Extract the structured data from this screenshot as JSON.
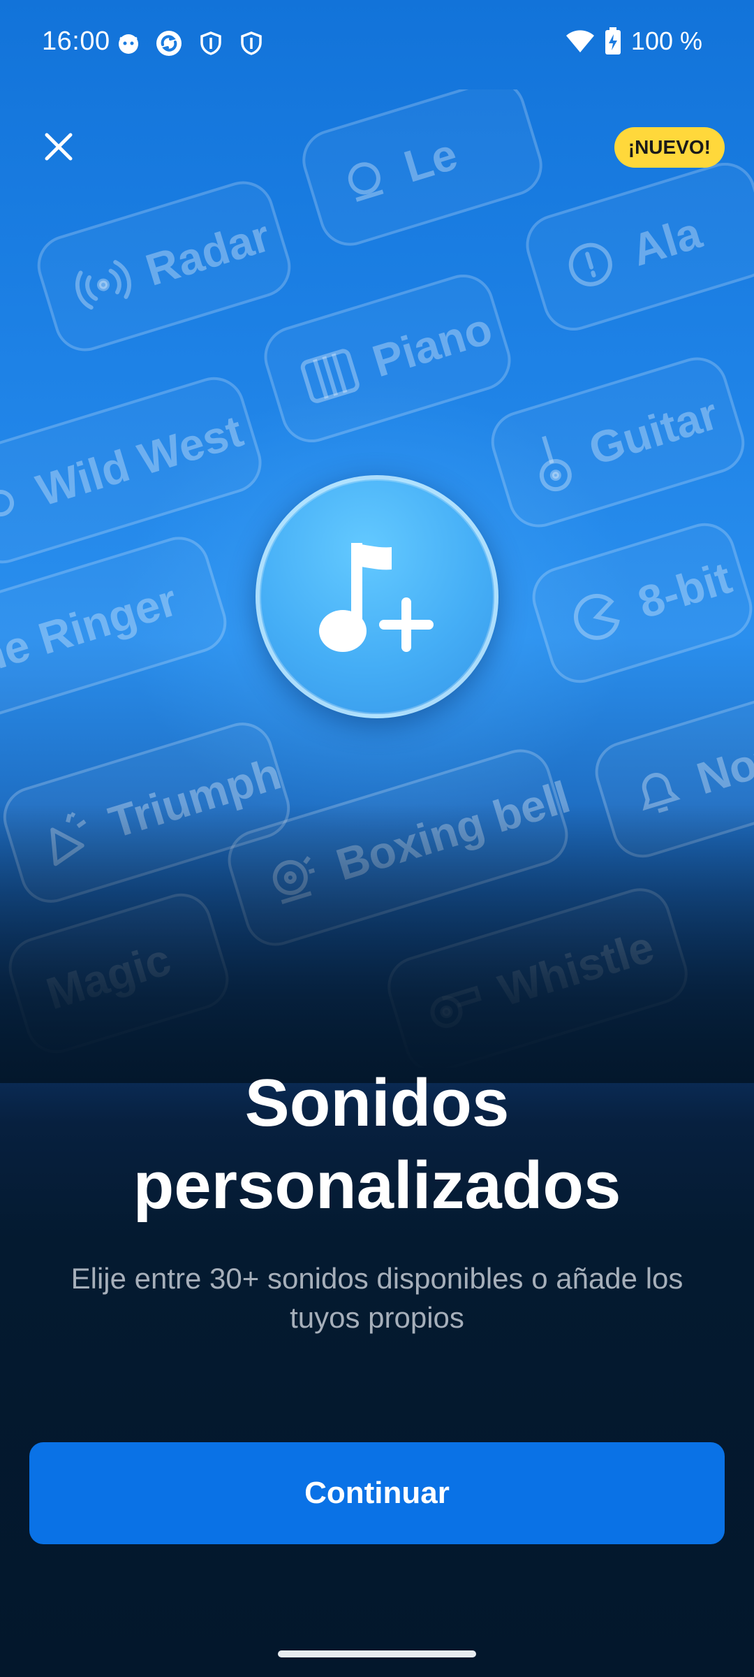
{
  "status_bar": {
    "time": "16:00",
    "battery": "100 %",
    "left_icons": [
      "cat-notification-icon",
      "sync-app-icon",
      "shield-icon",
      "shield-icon"
    ],
    "right_icons": [
      "wifi-icon",
      "battery-charging-icon"
    ]
  },
  "header": {
    "close_icon": "close-icon",
    "badge": "¡NUEVO!"
  },
  "sound_chips": [
    {
      "label": "Radar",
      "icon": "radar-icon"
    },
    {
      "label": "Le",
      "icon": "bell-ring-icon"
    },
    {
      "label": "Ala",
      "icon": "alert-icon"
    },
    {
      "label": "Piano",
      "icon": "piano-icon"
    },
    {
      "label": "Wild West",
      "icon": "wild-west-icon"
    },
    {
      "label": "Guitar",
      "icon": "guitar-icon"
    },
    {
      "label": "one Ringer",
      "icon": ""
    },
    {
      "label": "8-bit",
      "icon": "pacman-icon"
    },
    {
      "label": "Triumph",
      "icon": "party-horn-icon"
    },
    {
      "label": "Not",
      "icon": "bell-icon"
    },
    {
      "label": "Boxing bell",
      "icon": "boxing-bell-icon"
    },
    {
      "label": "Magic",
      "icon": ""
    },
    {
      "label": "Whistle",
      "icon": "whistle-icon"
    }
  ],
  "hero": {
    "icon": "music-note-plus-icon"
  },
  "content": {
    "title": "Sonidos personalizados",
    "subtitle": "Elije entre 30+ sonidos disponibles o añade los tuyos propios"
  },
  "actions": {
    "continue_label": "Continuar"
  },
  "colors": {
    "primary_button": "#0a72e6",
    "badge": "#ffd83b",
    "background_top": "#1273d9",
    "background_bottom": "#03172c"
  }
}
